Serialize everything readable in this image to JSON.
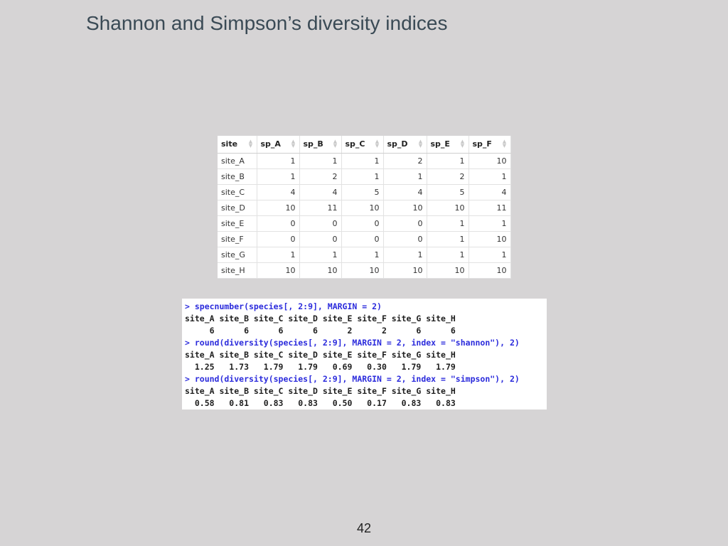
{
  "slide": {
    "title": "Shannon and Simpson’s diversity indices",
    "page_number": "42"
  },
  "table": {
    "columns": [
      "site",
      "sp_A",
      "sp_B",
      "sp_C",
      "sp_D",
      "sp_E",
      "sp_F"
    ],
    "rows": [
      [
        "site_A",
        "1",
        "1",
        "1",
        "2",
        "1",
        "10"
      ],
      [
        "site_B",
        "1",
        "2",
        "1",
        "1",
        "2",
        "1"
      ],
      [
        "site_C",
        "4",
        "4",
        "5",
        "4",
        "5",
        "4"
      ],
      [
        "site_D",
        "10",
        "11",
        "10",
        "10",
        "10",
        "11"
      ],
      [
        "site_E",
        "0",
        "0",
        "0",
        "0",
        "1",
        "1"
      ],
      [
        "site_F",
        "0",
        "0",
        "0",
        "0",
        "1",
        "10"
      ],
      [
        "site_G",
        "1",
        "1",
        "1",
        "1",
        "1",
        "1"
      ],
      [
        "site_H",
        "10",
        "10",
        "10",
        "10",
        "10",
        "10"
      ]
    ]
  },
  "console": {
    "lines": [
      {
        "type": "cmd",
        "text": "> specnumber(species[, 2:9], MARGIN = 2)"
      },
      {
        "type": "out",
        "text": "site_A site_B site_C site_D site_E site_F site_G site_H"
      },
      {
        "type": "out",
        "text": "     6      6      6      6      2      2      6      6"
      },
      {
        "type": "cmd",
        "text": "> round(diversity(species[, 2:9], MARGIN = 2, index = \"shannon\"), 2)"
      },
      {
        "type": "out",
        "text": "site_A site_B site_C site_D site_E site_F site_G site_H"
      },
      {
        "type": "out",
        "text": "  1.25   1.73   1.79   1.79   0.69   0.30   1.79   1.79"
      },
      {
        "type": "cmd",
        "text": "> round(diversity(species[, 2:9], MARGIN = 2, index = \"simpson\"), 2)"
      },
      {
        "type": "out",
        "text": "site_A site_B site_C site_D site_E site_F site_G site_H"
      },
      {
        "type": "out",
        "text": "  0.58   0.81   0.83   0.83   0.50   0.17   0.83   0.83"
      }
    ]
  }
}
